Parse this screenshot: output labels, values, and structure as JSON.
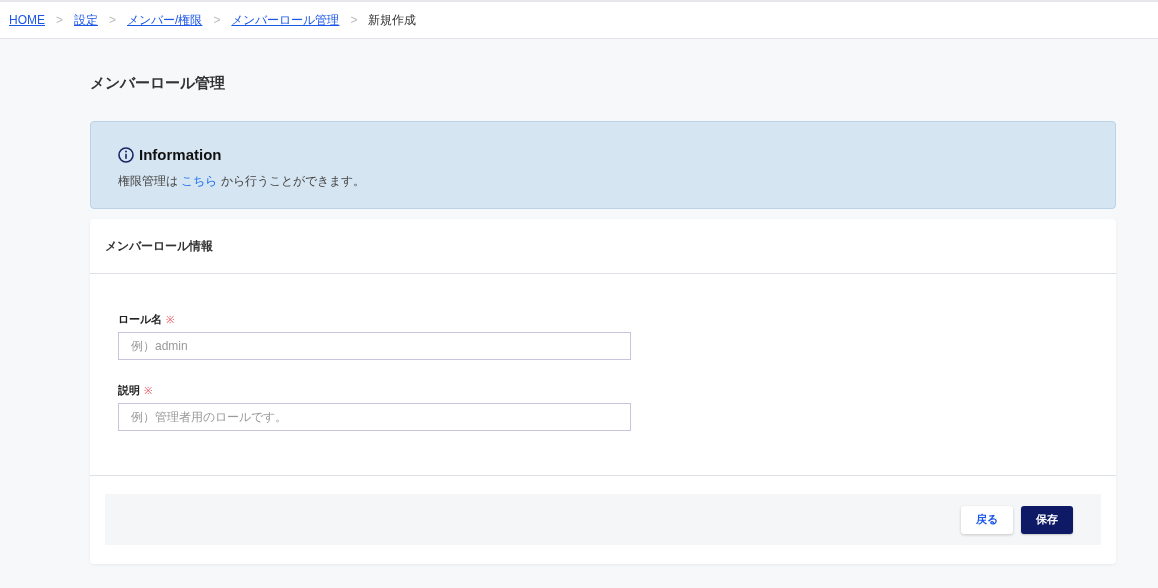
{
  "breadcrumbs": [
    {
      "label": "HOME",
      "link": true
    },
    {
      "label": "設定",
      "link": true
    },
    {
      "label": "メンバー/権限",
      "link": true
    },
    {
      "label": "メンバーロール管理",
      "link": true
    },
    {
      "label": "新規作成",
      "link": false
    }
  ],
  "breadcrumb_separator": ">",
  "page_title": "メンバーロール管理",
  "info": {
    "title": "Information",
    "text_before": "権限管理は ",
    "link": "こちら",
    "text_after": " から行うことができます。"
  },
  "card": {
    "title": "メンバーロール情報",
    "fields": [
      {
        "label": "ロール名",
        "required": true,
        "placeholder": "例）admin"
      },
      {
        "label": "説明",
        "required": true,
        "placeholder": "例）管理者用のロールです。"
      }
    ],
    "required_mark": "※",
    "buttons": [
      {
        "label": "戻る",
        "kind": "secondary"
      },
      {
        "label": "保存",
        "kind": "primary"
      }
    ]
  }
}
